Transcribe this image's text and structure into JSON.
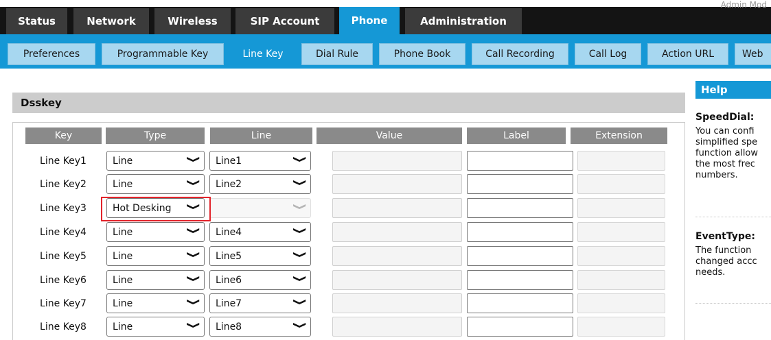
{
  "header": {
    "admin_text": "Admin Mod"
  },
  "main_tabs": [
    {
      "label": "Status"
    },
    {
      "label": "Network"
    },
    {
      "label": "Wireless"
    },
    {
      "label": "SIP Account"
    },
    {
      "label": "Phone"
    },
    {
      "label": "Administration"
    }
  ],
  "active_main_tab": "Phone",
  "sub_tabs": [
    {
      "label": "Preferences"
    },
    {
      "label": "Programmable Key"
    },
    {
      "label": "Line Key"
    },
    {
      "label": "Dial Rule"
    },
    {
      "label": "Phone Book"
    },
    {
      "label": "Call Recording"
    },
    {
      "label": "Call Log"
    },
    {
      "label": "Action URL"
    },
    {
      "label": "Web"
    }
  ],
  "active_sub_tab": "Line Key",
  "section": {
    "title": "Dsskey"
  },
  "table": {
    "columns": [
      "Key",
      "Type",
      "Line",
      "Value",
      "Label",
      "Extension"
    ],
    "rows": [
      {
        "key": "Line Key1",
        "type": "Line",
        "line": "Line1"
      },
      {
        "key": "Line Key2",
        "type": "Line",
        "line": "Line2"
      },
      {
        "key": "Line Key3",
        "type": "Hot Desking",
        "line": ""
      },
      {
        "key": "Line Key4",
        "type": "Line",
        "line": "Line4"
      },
      {
        "key": "Line Key5",
        "type": "Line",
        "line": "Line5"
      },
      {
        "key": "Line Key6",
        "type": "Line",
        "line": "Line6"
      },
      {
        "key": "Line Key7",
        "type": "Line",
        "line": "Line7"
      },
      {
        "key": "Line Key8",
        "type": "Line",
        "line": "Line8"
      }
    ]
  },
  "help": {
    "title": "Help",
    "sections": [
      {
        "heading": "SpeedDial:",
        "lines": [
          "You can confi",
          "simplified spe",
          "function allow",
          "the most frec",
          "numbers."
        ]
      },
      {
        "heading": "EventType:",
        "lines": [
          "The function",
          "changed accc",
          "needs."
        ]
      }
    ]
  },
  "colors": {
    "accent": "#1598d6",
    "highlight": "#e2232a",
    "topbar": "#141414"
  },
  "icons": {
    "select_arrow": "chevron-down-icon"
  }
}
